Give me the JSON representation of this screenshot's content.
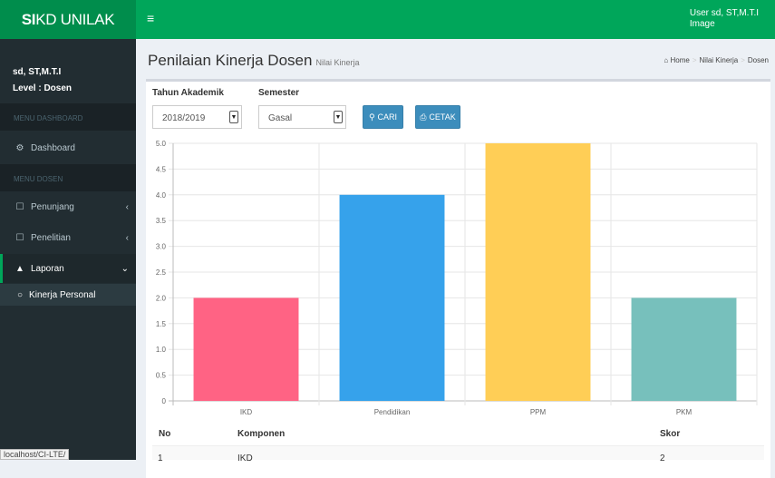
{
  "header": {
    "logo_bold": "SI",
    "logo_rest": "KD UNILAK",
    "toggle": "≡",
    "user_line1": "User  sd, ST,M.T.I",
    "user_line2": "Image"
  },
  "sidebar": {
    "user_name": "sd, ST,M.T.I",
    "user_level": "Level : Dosen",
    "section1": "MENU DASHBOARD",
    "dashboard": "Dashboard",
    "section2": "MENU DOSEN",
    "penunjang": "Penunjang",
    "penelitian": "Penelitian",
    "laporan": "Laporan",
    "kinerja": "Kinerja Personal"
  },
  "status_url": "localhost/CI-LTE/",
  "page": {
    "title": "Penilaian Kinerja Dosen",
    "subtitle": "Nilai Kinerja"
  },
  "breadcrumb": {
    "home": "Home",
    "item2": "Nilai Kinerja",
    "item3": "Dosen"
  },
  "filters": {
    "tahun_label": "Tahun Akademik",
    "tahun_value": "2018/2019",
    "semester_label": "Semester",
    "semester_value": "Gasal",
    "cari": "CARI",
    "cetak": "CETAK"
  },
  "chart_data": {
    "type": "bar",
    "categories": [
      "IKD",
      "Pendidikan",
      "PPM",
      "PKM"
    ],
    "values": [
      2,
      4,
      5,
      2
    ],
    "colors": [
      "#ff6384",
      "#36a2eb",
      "#ffce56",
      "#77c0bc"
    ],
    "ylim": [
      0,
      5
    ],
    "yticks": [
      "0",
      "0.5",
      "1.0",
      "1.5",
      "2.0",
      "2.5",
      "3.0",
      "3.5",
      "4.0",
      "4.5",
      "5.0"
    ],
    "grid": true
  },
  "table": {
    "headers": [
      "No",
      "Komponen",
      "Skor"
    ],
    "row1": [
      "1",
      "IKD",
      "2"
    ]
  }
}
